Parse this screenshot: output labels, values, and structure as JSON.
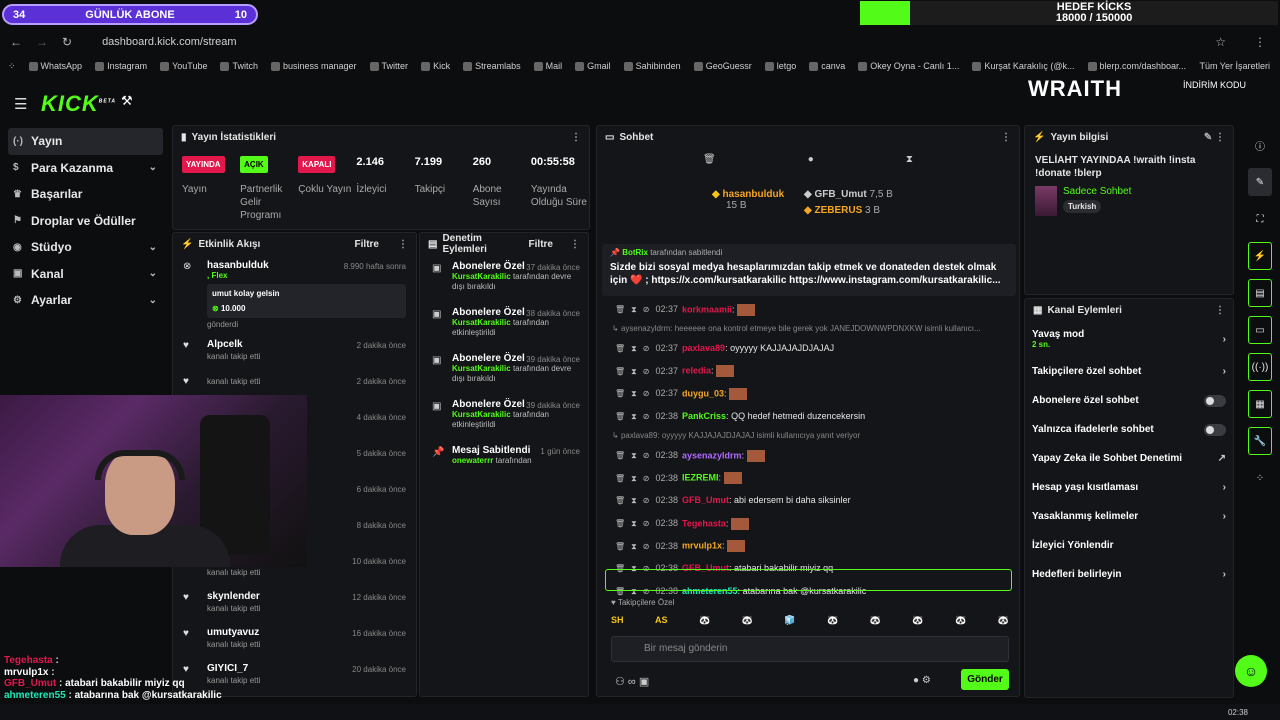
{
  "overlays": {
    "sub_goal": {
      "left": "34",
      "label": "GÜNLÜK ABONE",
      "right": "10"
    },
    "kick_goal": {
      "title": "HEDEF KİCKS",
      "value": "18000 / 150000",
      "progress": 0.12
    }
  },
  "browser": {
    "url": "dashboard.kick.com/stream",
    "bookmarks": [
      "WhatsApp",
      "Instagram",
      "YouTube",
      "Twitch",
      "business manager",
      "Twitter",
      "Kick",
      "Streamlabs",
      "Mail",
      "Gmail",
      "Sahibinden",
      "GeoGuessr",
      "letgo",
      "canva",
      "Okey Oyna - Canlı 1...",
      "Kurşat Karakılıç (@k...",
      "blerp.com/dashboar..."
    ],
    "all_bookmarks": "Tüm Yer İşaretleri"
  },
  "header": {
    "logo": "KICK",
    "logo_beta": "BETA",
    "banner": "WRAITH",
    "banner_sub": "İNDİRİM KODU"
  },
  "sidebar": {
    "items": [
      {
        "label": "Yayın",
        "icon": "(·)"
      },
      {
        "label": "Para Kazanma",
        "icon": "$"
      },
      {
        "label": "Başarılar",
        "icon": "♛"
      },
      {
        "label": "Droplar ve Ödüller",
        "icon": "⚑"
      },
      {
        "label": "Stüdyo",
        "icon": "◉"
      },
      {
        "label": "Kanal",
        "icon": "▣"
      },
      {
        "label": "Ayarlar",
        "icon": "⚙"
      }
    ]
  },
  "stats": {
    "title": "Yayın İstatistikleri",
    "items": [
      {
        "tag": "YAYINDA",
        "label": "Yayın"
      },
      {
        "tag": "AÇIK",
        "label": "Partnerlik Gelir Programı"
      },
      {
        "tag": "KAPALI",
        "label": "Çoklu Yayın"
      },
      {
        "value": "2.146",
        "label": "İzleyici"
      },
      {
        "value": "7.199",
        "label": "Takipçi"
      },
      {
        "value": "260",
        "label": "Abone Sayısı"
      },
      {
        "value": "00:55:58",
        "label": "Yayında Olduğu Süre"
      }
    ]
  },
  "activity": {
    "title": "Etkinlik Akışı",
    "filter": "Filtre",
    "gift": {
      "name": "hasanbulduk",
      "tier": "Flex",
      "time": "8.990 hafta sonra",
      "message": "umut kolay gelsin",
      "amount": "10.000",
      "sent": "gönderdi"
    },
    "follows": [
      {
        "name": "Alpcelk",
        "time": "2 dakika önce"
      },
      {
        "name": "",
        "time": "2 dakika önce"
      },
      {
        "name": "",
        "time": "4 dakika önce"
      },
      {
        "name": "",
        "time": "5 dakika önce"
      },
      {
        "name": "",
        "time": "6 dakika önce"
      },
      {
        "name": "",
        "time": "8 dakika önce"
      },
      {
        "name": "enesayten99",
        "time": "10 dakika önce"
      },
      {
        "name": "skynlender",
        "time": "12 dakika önce"
      },
      {
        "name": "umutyavuz",
        "time": "16 dakika önce"
      },
      {
        "name": "GIYICI_7",
        "time": "20 dakika önce"
      }
    ],
    "follow_text": "kanalı takip etti"
  },
  "moderation": {
    "title": "Denetim Eylemleri",
    "filter": "Filtre",
    "items": [
      {
        "title": "Abonelere Özel",
        "time": "37 dakika önce",
        "by": "KursatKarakilic",
        "rest": "tarafından devre dışı bırakıldı"
      },
      {
        "title": "Abonelere Özel",
        "time": "38 dakika önce",
        "by": "KursatKarakilic",
        "rest": "tarafından etkinleştirildi"
      },
      {
        "title": "Abonelere Özel",
        "time": "39 dakika önce",
        "by": "KursatKarakilic",
        "rest": "tarafından devre dışı bırakıldı"
      },
      {
        "title": "Abonelere Özel",
        "time": "39 dakika önce",
        "by": "KursatKarakilic",
        "rest": "tarafından etkinleştirildi"
      },
      {
        "title": "Mesaj Sabitlendi",
        "time": "1 gün önce",
        "by": "onewaterrr",
        "rest": "tarafından"
      }
    ]
  },
  "chat": {
    "title": "Sohbet",
    "top_gifter": {
      "name": "hasanbulduk",
      "amount": "15 B"
    },
    "gifters": [
      {
        "name": "GFB_Umut",
        "amount": "7,5 B"
      },
      {
        "name": "ZEBERUS",
        "amount": "3 B"
      }
    ],
    "hidden_line": "JANEJDOWNWPDNXKW",
    "pinned": {
      "by": "BotRix",
      "by_rest": "tarafından sabitlendi",
      "text": "Sizde bizi sosyal medya hesaplarımızdan takip etmek ve donateden destek olmak için ❤️ ; https://x.com/kursatkarakilic https://www.instagram.com/kursatkarakilic..."
    },
    "messages": [
      {
        "time": "02:37",
        "user": "korkmaamii",
        "text": "",
        "color": "#e2174c"
      },
      {
        "reply": "aysenazyldrm: heeeeee ona kontrol etmeye bile gerek yok JANEJDOWNWPDNXKW isimli kullanıcı..."
      },
      {
        "time": "02:37",
        "user": "paxlava89",
        "text": "oyyyyy KAJJAJAJDJAJAJ",
        "color": "#e2174c"
      },
      {
        "time": "02:37",
        "user": "reledia",
        "text": "",
        "color": "#e2174c"
      },
      {
        "time": "02:37",
        "user": "duygu_03",
        "text": "",
        "color": "#f5a623"
      },
      {
        "time": "02:38",
        "user": "PankCriss",
        "text": "QQ hedef hetmedi duzencekersin",
        "color": "#53fc18"
      },
      {
        "reply": "paxlava89: oyyyyy KAJJAJAJDJAJAJ isimli kullanıcıya yanıt veriyor"
      },
      {
        "time": "02:38",
        "user": "aysenazyldrm",
        "text": "",
        "color": "#b06bff"
      },
      {
        "time": "02:38",
        "user": "IEZREMI",
        "text": "",
        "color": "#53fc18"
      },
      {
        "time": "02:38",
        "user": "GFB_Umut",
        "text": "abi edersem bi daha siksinler",
        "color": "#e2174c"
      },
      {
        "time": "02:38",
        "user": "Tegehasta",
        "text": "",
        "color": "#e2174c"
      },
      {
        "time": "02:38",
        "user": "mrvulp1x",
        "text": "",
        "color": "#f5a623"
      },
      {
        "time": "02:38",
        "user": "GFB_Umut",
        "text": "atabari bakabilir miyiz qq",
        "color": "#e2174c"
      },
      {
        "time": "02:38",
        "user": "ahmeteren55",
        "text": "atabarına bak @kursatkarakilic",
        "color": "#1de9b6"
      }
    ],
    "followers_only": "Takipçilere Özel",
    "emotes": [
      "SH",
      "AS",
      "🐼",
      "🐼",
      "🧊",
      "🐼",
      "🐼",
      "🐼",
      "🐼",
      "🐼"
    ],
    "input_placeholder": "Bir mesaj gönderin",
    "send": "Gönder"
  },
  "stream_info": {
    "title": "Yayın bilgisi",
    "text": "VELİAHT YAYINDAA !wraith !insta !donate !blerp",
    "category": "Sadece Sohbet",
    "tag": "Turkish"
  },
  "channel_actions": {
    "title": "Kanal Eylemleri",
    "items": [
      {
        "label": "Yavaş mod",
        "sub": "2 sn.",
        "ctl": "chevron"
      },
      {
        "label": "Takipçilere özel sohbet",
        "ctl": "chevron"
      },
      {
        "label": "Abonelere özel sohbet",
        "ctl": "toggle"
      },
      {
        "label": "Yalnızca ifadelerle sohbet",
        "ctl": "toggle"
      },
      {
        "label": "Yapay Zeka ile Sohbet Denetimi",
        "ctl": "ext"
      },
      {
        "label": "Hesap yaşı kısıtlaması",
        "ctl": "chevron"
      },
      {
        "label": "Yasaklanmış kelimeler",
        "ctl": "chevron"
      },
      {
        "label": "İzleyici Yönlendir",
        "ctl": "none"
      },
      {
        "label": "Hedefleri belirleyin",
        "ctl": "chevron"
      }
    ]
  },
  "overlay_chat": [
    {
      "user": "Tegehasta",
      "text": "",
      "color": "#e2174c"
    },
    {
      "user": "mrvulp1x",
      "text": "",
      "color": "#ffffff"
    },
    {
      "user": "GFB_Umut",
      "text": "atabari bakabilir miyiz qq",
      "color": "#e2174c"
    },
    {
      "user": "ahmeteren55",
      "text": "atabarına bak @kursatkarakilic",
      "color": "#1de9b6"
    }
  ],
  "clock": "02:38"
}
